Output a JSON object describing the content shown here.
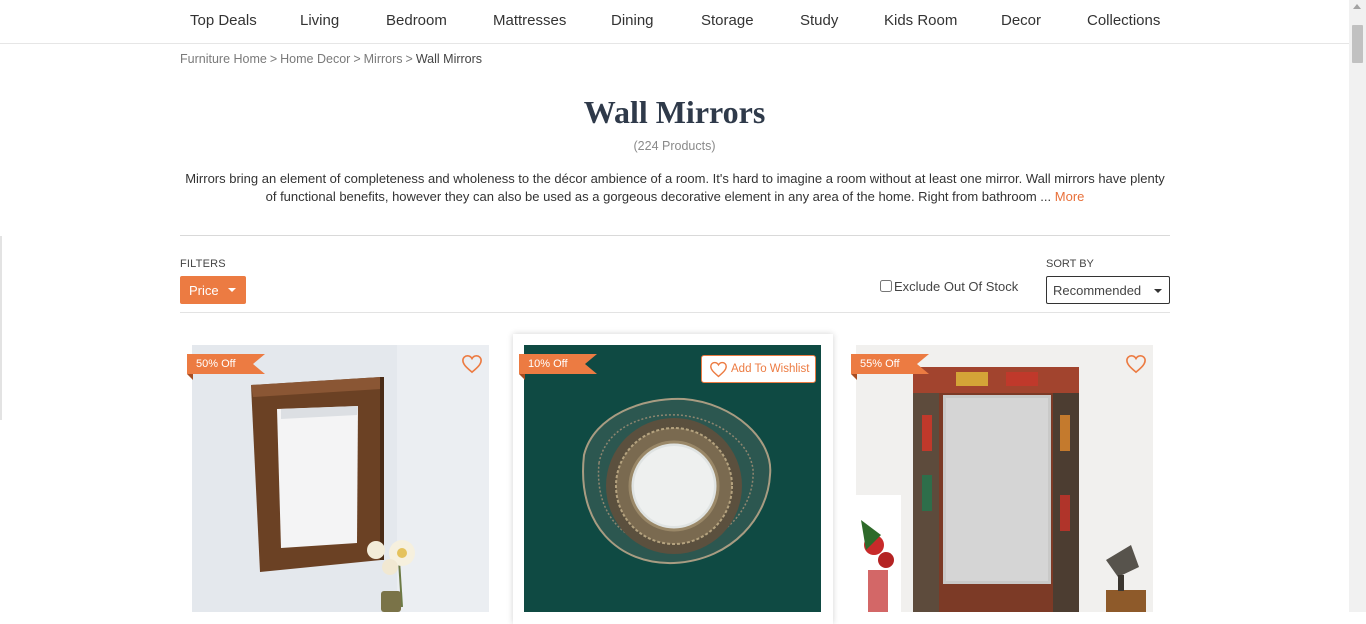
{
  "nav": {
    "items": [
      "Top Deals",
      "Living",
      "Bedroom",
      "Mattresses",
      "Dining",
      "Storage",
      "Study",
      "Kids Room",
      "Decor",
      "Collections"
    ]
  },
  "breadcrumb": {
    "items": [
      "Furniture Home",
      "Home Decor",
      "Mirrors"
    ],
    "separator": ">",
    "current": "Wall Mirrors"
  },
  "page": {
    "title": "Wall Mirrors",
    "count": "(224 Products)",
    "description": "Mirrors bring an element of completeness and wholeness to the décor ambience of a room. It's hard to imagine a room without at least one mirror. Wall mirrors have plenty of functional benefits, however they can also be used as a gorgeous decorative element in any area of the home. Right from bathroom ...",
    "more_label": "More"
  },
  "filters": {
    "label": "FILTERS",
    "price_label": "Price",
    "exclude_label": "Exclude Out Of Stock",
    "exclude_checked": false,
    "sort_label": "SORT BY",
    "sort_value": "Recommended"
  },
  "products": [
    {
      "badge": "50% Off",
      "image": "wooden-frame-square-mirror"
    },
    {
      "badge": "10% Off",
      "image": "round-mesh-mirror-on-green-wall",
      "wishlist_label": "Add To Wishlist"
    },
    {
      "badge": "55% Off",
      "image": "painted-rectangular-frame-mirror"
    }
  ],
  "colors": {
    "accent": "#ec7b42",
    "title": "#2f3a4a"
  }
}
